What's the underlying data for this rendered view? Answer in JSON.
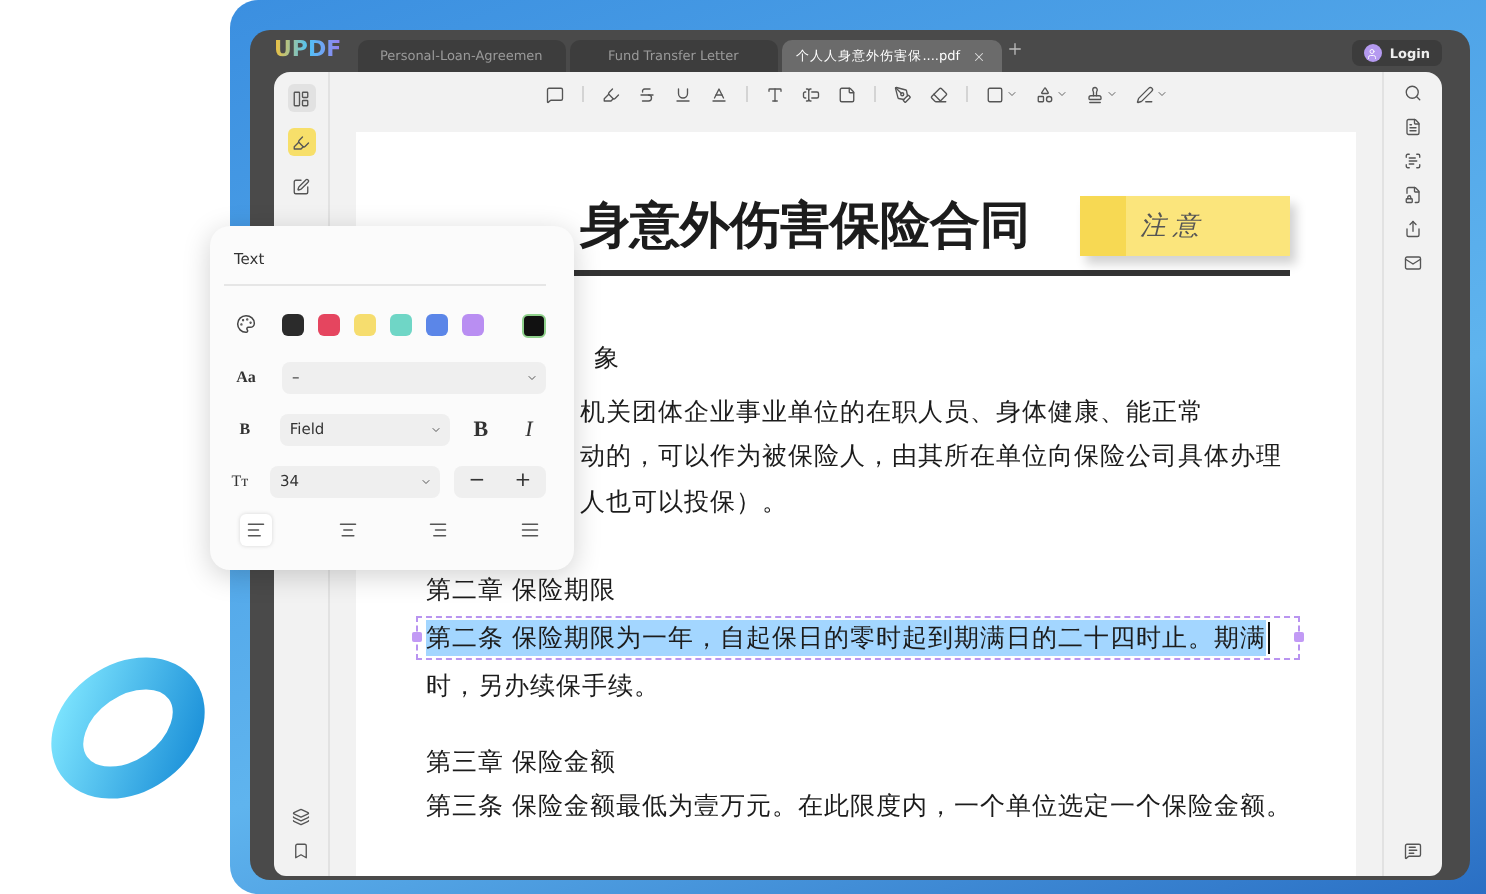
{
  "app": {
    "logo": "UPDF",
    "login": "Login"
  },
  "tabs": [
    {
      "label": "Personal-Loan-Agreemen",
      "selected": false
    },
    {
      "label": "Fund Transfer Letter",
      "selected": false
    },
    {
      "label": "个人人身意外伤害保....pdf",
      "selected": true
    }
  ],
  "left_sidebar": [
    {
      "kind": "thumbnails",
      "selected": false
    },
    {
      "kind": "comment",
      "selected": true
    },
    {
      "kind": "edit",
      "selected": false
    }
  ],
  "document": {
    "title": "身意外伤害保险合同",
    "sticky_note": "注 意",
    "covered_lines": [
      "象",
      "机关团体企业事业单位的在职人员、身体健康、能正常",
      "动的，可以作为被保险人，由其所在单位向保险公司具体办理",
      "人也可以投保）。"
    ],
    "sections": [
      {
        "kind": "heading",
        "text": "第二章  保险期限"
      },
      {
        "kind": "selected",
        "text": "第二条  保险期限为一年，自起保日的零时起到期满日的二十四时止。期满"
      },
      {
        "kind": "body",
        "text": "时，另办续保手续。"
      },
      {
        "kind": "heading",
        "text": "第三章  保险金额"
      },
      {
        "kind": "body",
        "text": "第三条  保险金额最低为壹万元。在此限度内，一个单位选定一个保险金额。"
      }
    ]
  },
  "text_panel": {
    "title": "Text",
    "swatches": [
      {
        "color": "#2b2b2b"
      },
      {
        "color": "#e5455f"
      },
      {
        "color": "#f6dd6e"
      },
      {
        "color": "#6fd6c6"
      },
      {
        "color": "#5b86e8"
      },
      {
        "color": "#b98ef2"
      }
    ],
    "font_label": "Aa",
    "font": "–",
    "style_label": "B",
    "style": "Field",
    "bold": "B",
    "italic": "I",
    "size_label": "Tт",
    "size": "34",
    "minus": "−",
    "plus": "+",
    "align": [
      {
        "kind": "left",
        "selected": true
      },
      {
        "kind": "center",
        "selected": false
      },
      {
        "kind": "right",
        "selected": false
      },
      {
        "kind": "justify",
        "selected": false
      }
    ]
  }
}
